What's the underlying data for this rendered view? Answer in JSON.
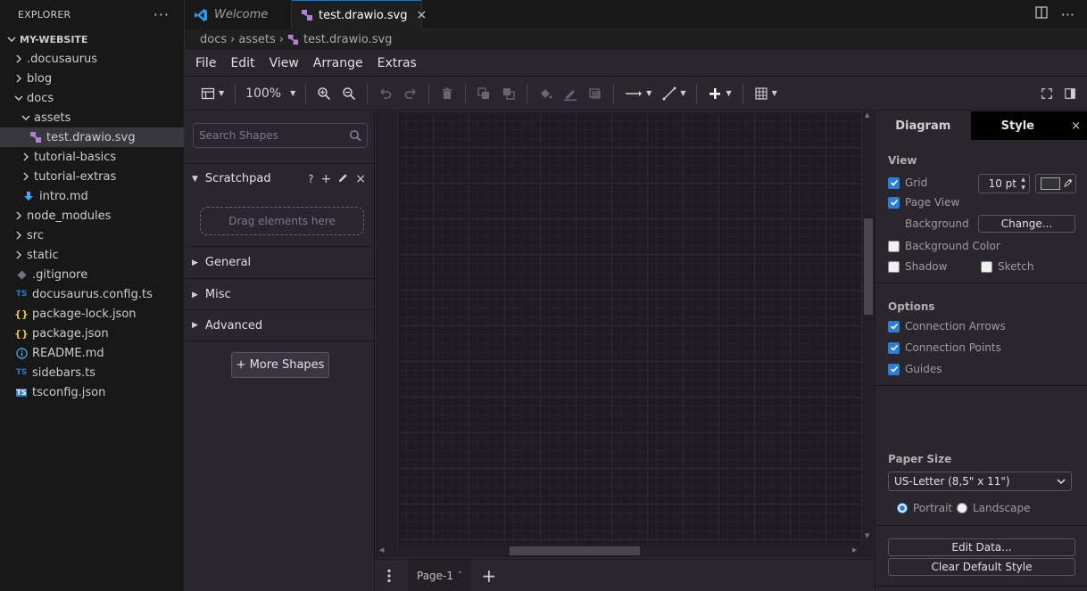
{
  "explorer": {
    "title": "EXPLORER",
    "more": "···",
    "root": "MY-WEBSITE",
    "items": [
      {
        "label": ".docusaurus",
        "type": "folder",
        "open": false,
        "depth": 1
      },
      {
        "label": "blog",
        "type": "folder",
        "open": false,
        "depth": 1
      },
      {
        "label": "docs",
        "type": "folder",
        "open": true,
        "depth": 1
      },
      {
        "label": "assets",
        "type": "folder",
        "open": true,
        "depth": 2
      },
      {
        "label": "test.drawio.svg",
        "type": "drawio",
        "depth": 3,
        "selected": true
      },
      {
        "label": "tutorial-basics",
        "type": "folder",
        "open": false,
        "depth": 2
      },
      {
        "label": "tutorial-extras",
        "type": "folder",
        "open": false,
        "depth": 2
      },
      {
        "label": "intro.md",
        "type": "md",
        "depth": 2
      },
      {
        "label": "node_modules",
        "type": "folder",
        "open": false,
        "depth": 1
      },
      {
        "label": "src",
        "type": "folder",
        "open": false,
        "depth": 1
      },
      {
        "label": "static",
        "type": "folder",
        "open": false,
        "depth": 1
      },
      {
        "label": ".gitignore",
        "type": "git",
        "depth": 1
      },
      {
        "label": "docusaurus.config.ts",
        "type": "ts",
        "depth": 1
      },
      {
        "label": "package-lock.json",
        "type": "json",
        "depth": 1
      },
      {
        "label": "package.json",
        "type": "json",
        "depth": 1
      },
      {
        "label": "README.md",
        "type": "info",
        "depth": 1
      },
      {
        "label": "sidebars.ts",
        "type": "ts",
        "depth": 1
      },
      {
        "label": "tsconfig.json",
        "type": "tsjson",
        "depth": 1
      }
    ]
  },
  "tabs": {
    "welcome": "Welcome",
    "active": "test.drawio.svg",
    "close": "×"
  },
  "breadcrumb": [
    "docs",
    "assets",
    "test.drawio.svg"
  ],
  "menu": [
    "File",
    "Edit",
    "View",
    "Arrange",
    "Extras"
  ],
  "toolbar": {
    "zoom": "100%"
  },
  "shapes": {
    "search_placeholder": "Search Shapes",
    "scratchpad": "Scratchpad",
    "scratch_help": "?",
    "dropzone": "Drag elements here",
    "sections": [
      "General",
      "Misc",
      "Advanced"
    ],
    "more_shapes": "+ More Shapes"
  },
  "pages": {
    "current": "Page-1"
  },
  "format": {
    "tab_diagram": "Diagram",
    "tab_style": "Style",
    "view_title": "View",
    "grid": "Grid",
    "grid_size": "10 pt",
    "page_view": "Page View",
    "background": "Background",
    "change": "Change...",
    "background_color": "Background Color",
    "shadow": "Shadow",
    "sketch": "Sketch",
    "options_title": "Options",
    "connection_arrows": "Connection Arrows",
    "connection_points": "Connection Points",
    "guides": "Guides",
    "paper_title": "Paper Size",
    "paper_size": "US-Letter (8,5\" x 11\")",
    "portrait": "Portrait",
    "landscape": "Landscape",
    "edit_data": "Edit Data...",
    "clear_style": "Clear Default Style"
  },
  "colors": {
    "accent": "#2a7fd4",
    "vscode_blue": "#0078d4",
    "drawio_bg": "#2a252f"
  }
}
